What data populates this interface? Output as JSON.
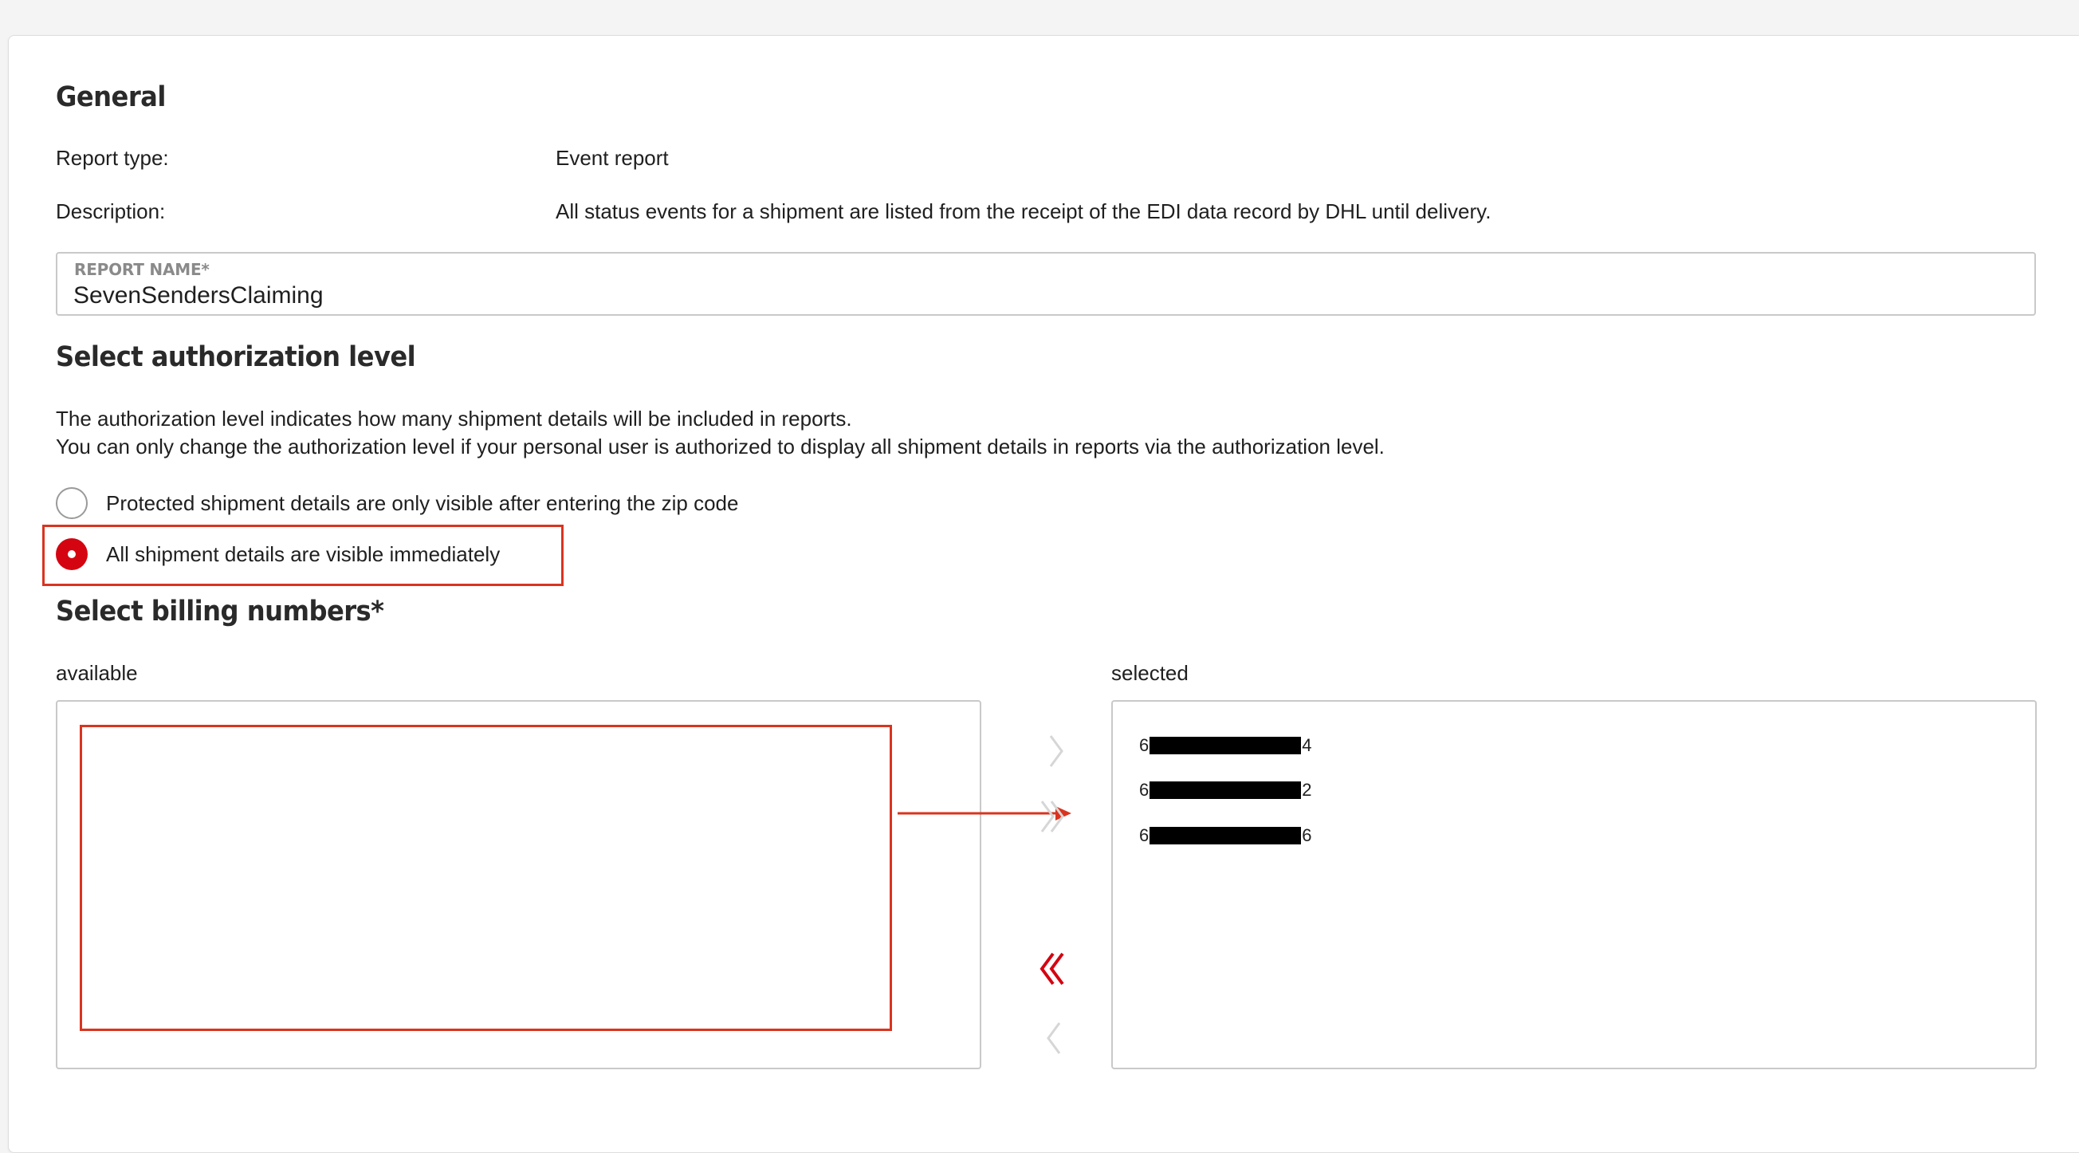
{
  "general": {
    "heading": "General",
    "report_type_label": "Report type:",
    "report_type_value": "Event report",
    "description_label": "Description:",
    "description_value": "All status events for a shipment are listed from the receipt of the EDI data record by DHL until delivery."
  },
  "report_name": {
    "label": "REPORT NAME*",
    "value": "SevenSendersClaiming"
  },
  "authorization": {
    "heading": "Select authorization level",
    "info_line1": "The authorization level indicates how many shipment details will be included in reports.",
    "info_line2": "You can only change the authorization level if your personal user is authorized to display all shipment details in reports via the authorization level.",
    "options": [
      {
        "label": "Protected shipment details are only visible after entering the zip code",
        "selected": false
      },
      {
        "label": "All shipment details are visible immediately",
        "selected": true
      }
    ]
  },
  "billing": {
    "heading": "Select billing numbers*",
    "available_label": "available",
    "selected_label": "selected",
    "available_items": [],
    "selected_items": [
      {
        "prefix": "6",
        "suffix": "4"
      },
      {
        "prefix": "6",
        "suffix": "2"
      },
      {
        "prefix": "6",
        "suffix": "6"
      }
    ]
  },
  "colors": {
    "accent_red": "#d40511",
    "annotation_red": "#d9341f",
    "disabled_chevron": "#d6d6d6"
  },
  "icons": {
    "move_right": "chevron-right-icon",
    "move_all_right": "double-chevron-right-icon",
    "move_all_left": "double-chevron-left-icon",
    "move_left": "chevron-left-icon"
  }
}
